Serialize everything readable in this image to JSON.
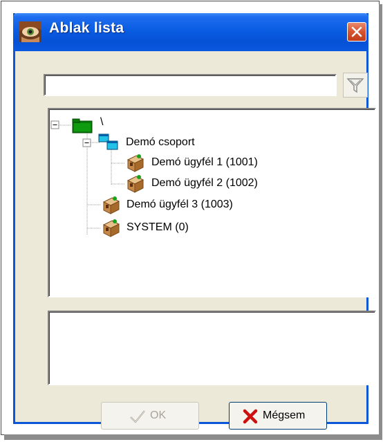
{
  "window": {
    "title": "Ablak lista",
    "close_icon": "close-icon",
    "app_icon": "eye-app-icon"
  },
  "search": {
    "value": "",
    "placeholder": ""
  },
  "filter_button": {
    "icon": "filter-funnel-icon"
  },
  "tree": {
    "root": {
      "label": "\\",
      "icon": "green-folder-icon",
      "expanded": true
    },
    "group": {
      "label": "Demó csoport",
      "icon": "windows-group-icon",
      "expanded": true
    },
    "items": [
      {
        "label": "Demó ügyfél 1 (1001)",
        "icon": "client-computer-icon"
      },
      {
        "label": "Demó ügyfél 2 (1002)",
        "icon": "client-computer-icon"
      },
      {
        "label": "Demó ügyfél 3 (1003)",
        "icon": "client-computer-icon"
      },
      {
        "label": "SYSTEM (0)",
        "icon": "client-computer-icon"
      }
    ]
  },
  "info_panel": {
    "text": ""
  },
  "buttons": {
    "ok": {
      "label": "OK",
      "enabled": false,
      "icon": "checkmark-icon"
    },
    "cancel": {
      "label": "Mégsem",
      "enabled": true,
      "icon": "red-x-icon"
    }
  },
  "colors": {
    "titlebar": "#0a5ce2",
    "close": "#d8532f",
    "face": "#ece9d8",
    "cancel_x": "#cc1010"
  }
}
